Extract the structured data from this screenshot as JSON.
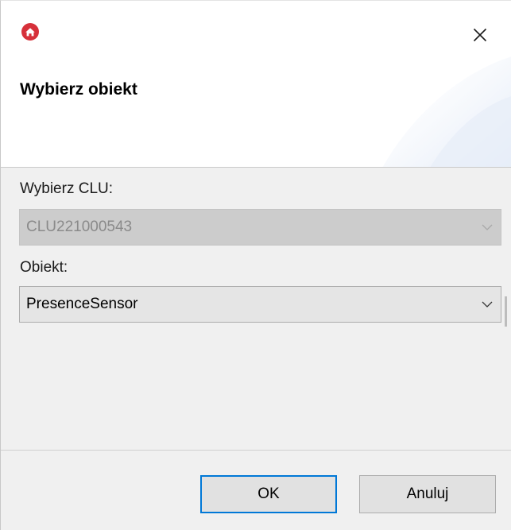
{
  "window": {
    "title": "Wybierz obiekt",
    "app_icon": "home-icon",
    "close_icon": "close-icon",
    "accent_color": "#d6303a"
  },
  "form": {
    "clu_label": "Wybierz CLU:",
    "clu_value": "CLU221000543",
    "clu_disabled": true,
    "object_label": "Obiekt:",
    "object_value": "PresenceSensor"
  },
  "buttons": {
    "ok": "OK",
    "cancel": "Anuluj"
  }
}
